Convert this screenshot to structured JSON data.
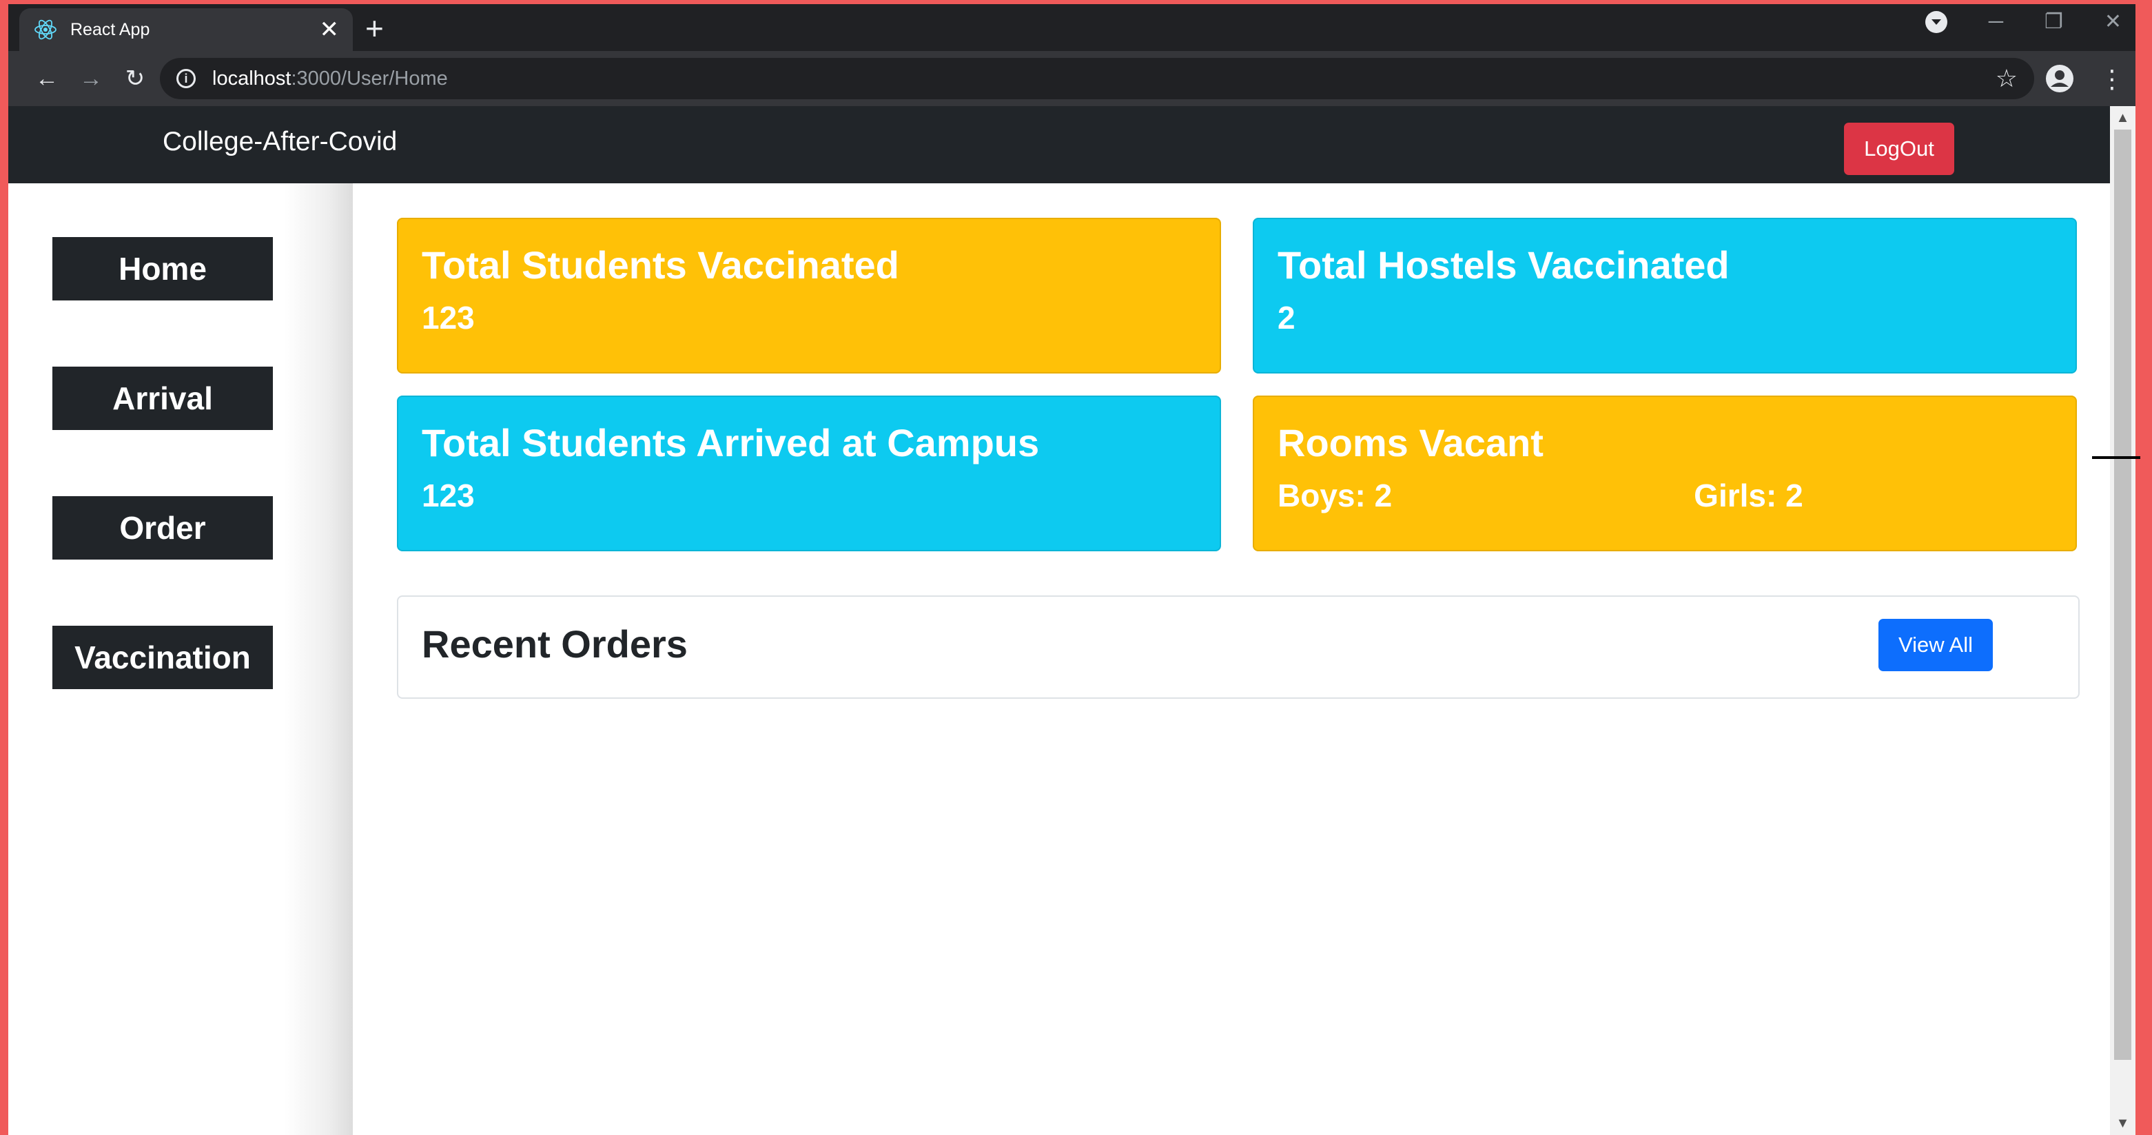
{
  "browser": {
    "tab_title": "React App",
    "tab_close": "✕",
    "new_tab": "+",
    "url_host": "localhost",
    "url_path": ":3000/User/Home"
  },
  "navbar": {
    "brand": "College-After-Covid",
    "logout_label": "LogOut"
  },
  "sidebar": {
    "items": [
      {
        "label": "Home"
      },
      {
        "label": "Arrival"
      },
      {
        "label": "Order"
      },
      {
        "label": "Vaccination"
      }
    ]
  },
  "cards": {
    "students_vaccinated": {
      "title": "Total Students Vaccinated",
      "value": "123"
    },
    "hostels_vaccinated": {
      "title": "Total Hostels Vaccinated",
      "value": "2"
    },
    "students_arrived": {
      "title": "Total Students Arrived at Campus",
      "value": "123"
    },
    "rooms_vacant": {
      "title": "Rooms Vacant",
      "boys": "Boys: 2",
      "girls": "Girls: 2"
    }
  },
  "recent_orders": {
    "title": "Recent Orders",
    "view_all_label": "View All"
  },
  "colors": {
    "navbar": "#212529",
    "danger": "#dc3545",
    "warning": "#ffc107",
    "info": "#0dcaf0",
    "primary": "#0d6efd"
  }
}
